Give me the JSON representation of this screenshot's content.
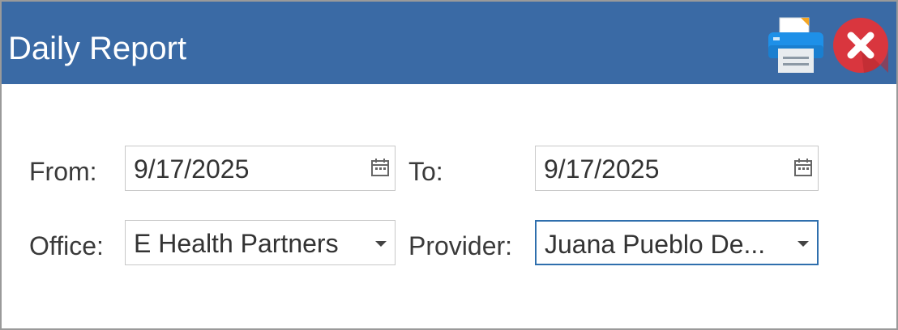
{
  "window": {
    "title": "Daily Report",
    "title_bar_color": "#3a6aa5"
  },
  "toolbar": {
    "print_icon": "printer-icon",
    "close_icon": "close-icon"
  },
  "form": {
    "from_label": "From:",
    "from_value": "9/17/2025",
    "to_label": "To:",
    "to_value": "9/17/2025",
    "office_label": "Office:",
    "office_value": "E Health Partners",
    "provider_label": "Provider:",
    "provider_value": "Juana Pueblo De..."
  }
}
